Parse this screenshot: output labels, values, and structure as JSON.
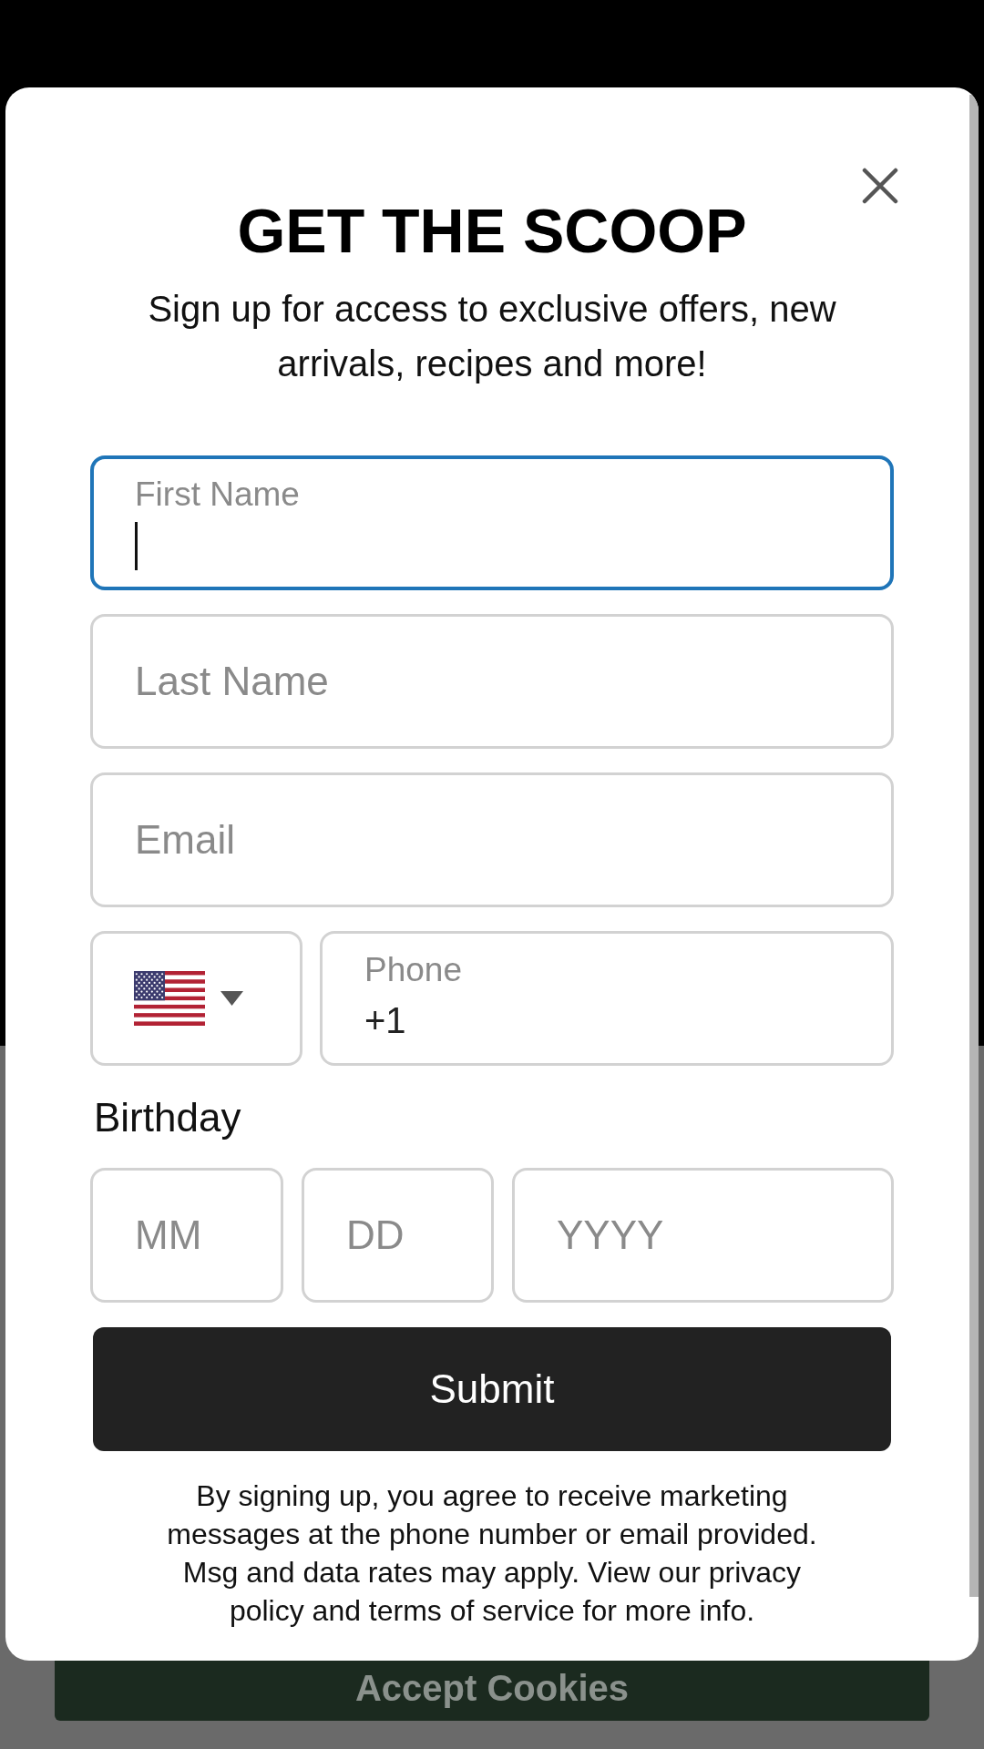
{
  "backdrop": {
    "cookie_button": "Accept Cookies"
  },
  "modal": {
    "title": "GET THE SCOOP",
    "subtitle": "Sign up for access to exclusive offers, new arrivals, recipes and more!",
    "fields": [
      {
        "kind": "floating",
        "label": "First Name",
        "focused": true
      },
      {
        "kind": "placeholder",
        "placeholder": "Last Name",
        "focused": false
      },
      {
        "kind": "placeholder",
        "placeholder": "Email",
        "focused": false
      }
    ],
    "phone": {
      "country_select": {
        "focused": false
      },
      "label": "Phone",
      "value": "+1",
      "focused": false
    },
    "birthday": {
      "label": "Birthday",
      "fields": [
        {
          "placeholder": "MM",
          "focused": false
        },
        {
          "placeholder": "DD",
          "focused": false
        },
        {
          "placeholder": "YYYY",
          "focused": false
        }
      ]
    },
    "submit": "Submit",
    "disclaimer": "By signing up, you agree to receive marketing messages at the phone number or email provided. Msg and data rates may apply. View our privacy policy and terms of service for more info."
  }
}
